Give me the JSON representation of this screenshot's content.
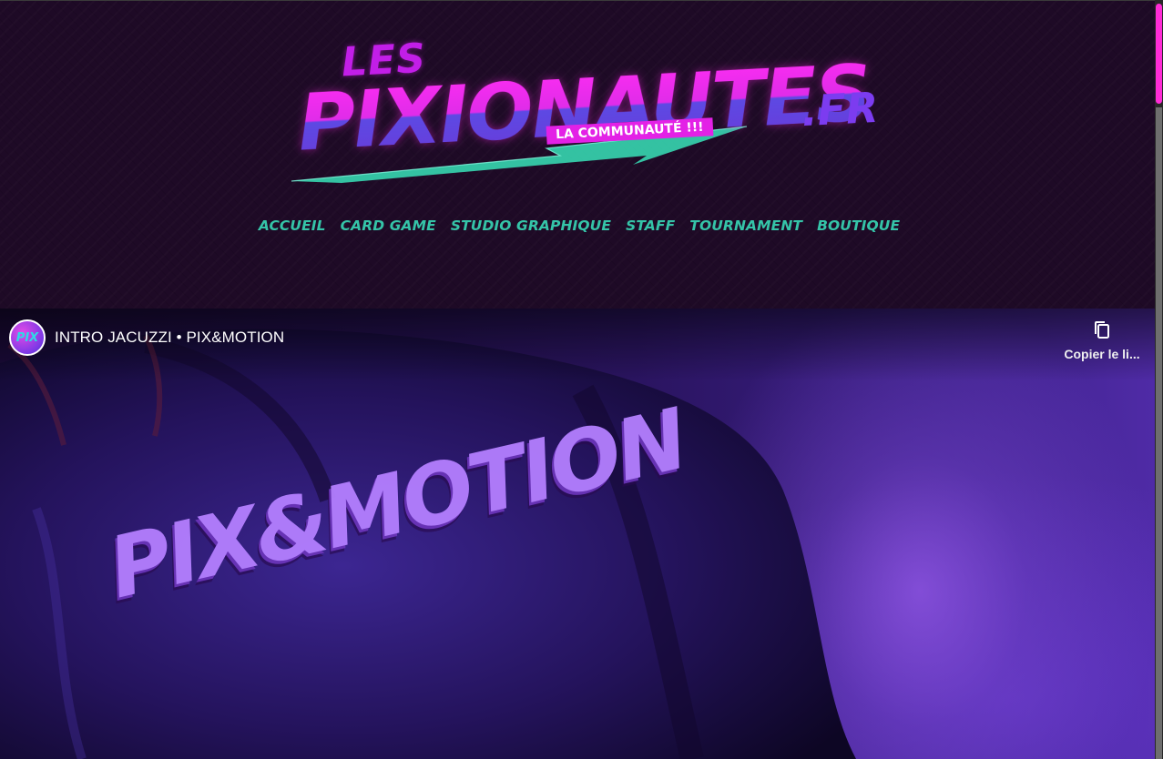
{
  "header": {
    "logo": {
      "les": "LES",
      "main": "PIXIONAUTES",
      "tld": ".FR",
      "badge": "LA COMMUNAUTÉ !!!"
    },
    "nav": [
      {
        "label": "ACCUEIL"
      },
      {
        "label": "CARD GAME"
      },
      {
        "label": "STUDIO GRAPHIQUE"
      },
      {
        "label": "STAFF"
      },
      {
        "label": "TOURNAMENT"
      },
      {
        "label": "BOUTIQUE"
      }
    ]
  },
  "video": {
    "channel_avatar": "PIX",
    "title": "INTRO JACUZZI • PIX&MOTION",
    "copy_link_label": "Copier le li...",
    "overlay_text": "PIX&MOTION"
  },
  "colors": {
    "nav": "#35c4a8",
    "accent_pink": "#ff2bd6",
    "header_bg": "#1e0a26"
  },
  "icons": [
    "copy-icon",
    "channel-avatar"
  ]
}
